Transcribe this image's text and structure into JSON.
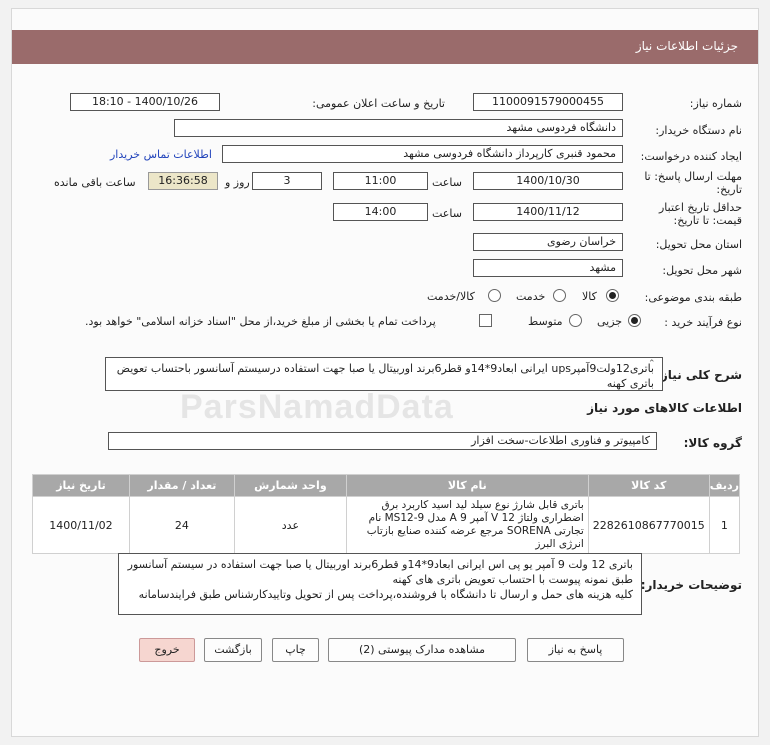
{
  "header": {
    "title": "جزئیات اطلاعات نیاز"
  },
  "need_number": {
    "label": "شماره نیاز:",
    "value": "1100091579000455"
  },
  "announce": {
    "label": "تاریخ و ساعت اعلان عمومی:",
    "value": "1400/10/26 - 18:10"
  },
  "buyer_org": {
    "label": "نام دستگاه خریدار:",
    "value": "دانشگاه فردوسی مشهد"
  },
  "requester": {
    "label": "ایجاد کننده درخواست:",
    "value": "محمود قنبری کارپرداز دانشگاه فردوسی مشهد",
    "contact_link": "اطلاعات تماس خریدار"
  },
  "deadline": {
    "label_line1": "مهلت ارسال پاسخ: تا",
    "label_line2": "تاریخ:",
    "date": "1400/10/30",
    "time_label": "ساعت",
    "time": "11:00",
    "days": "3",
    "days_label": "روز و",
    "remaining": "16:36:58",
    "remaining_label": "ساعت باقی مانده"
  },
  "validity": {
    "label_line1": "حداقل تاریخ اعتبار",
    "label_line2": "قیمت: تا تاریخ:",
    "date": "1400/11/12",
    "time_label": "ساعت",
    "time": "14:00"
  },
  "province": {
    "label": "استان محل تحویل:",
    "value": "خراسان رضوی"
  },
  "city": {
    "label": "شهر محل تحویل:",
    "value": "مشهد"
  },
  "category": {
    "label": "طبقه بندی موضوعی:",
    "options": [
      "کالا",
      "خدمت",
      "کالا/خدمت"
    ],
    "selected": "کالا"
  },
  "process": {
    "label": "نوع فرآیند خرید :",
    "options": [
      "جزیی",
      "متوسط"
    ],
    "selected": "جزیی",
    "payment_note": "پرداخت تمام یا بخشی از مبلغ خرید،از محل \"اسناد خزانه اسلامی\" خواهد بود."
  },
  "summary": {
    "label": "شرح کلی نیاز:",
    "value": "باتری12ولت9آمپرups ایرانی ابعاد9*14و قطر6برند اوربیتال یا صبا جهت استفاده درسیستم آسانسور باحتساب تعویض باتری کهنه"
  },
  "goods_info": {
    "title": "اطلاعات کالاهای مورد نیاز"
  },
  "goods_group": {
    "label": "گروه کالا:",
    "value": "کامپیوتر و فناوری اطلاعات-سخت افزار"
  },
  "table": {
    "headers": [
      "ردیف",
      "کد کالا",
      "نام کالا",
      "واحد شمارش",
      "تعداد / مقدار",
      "تاریخ نیاز"
    ],
    "rows": [
      {
        "row": "1",
        "code": "2282610867770015",
        "name": "باتری قابل شارژ نوع سیلد لید اسید کاربرد برق اضطراری ولتاژ 12 V آمپر 9 A مدل MS12-9 نام تجارتی SORENA مرجع عرضه کننده صنایع بازتاب انرژی البرز",
        "unit": "عدد",
        "qty": "24",
        "date": "1400/11/02"
      }
    ]
  },
  "buyer_notes": {
    "label": "توضیحات خریدار:",
    "value": "باتری 12 ولت 9 آمپر یو پی اس ایرانی ابعاد9*14و قطر6برند اوربیتال یا صبا جهت استفاده در سیستم آسانسور طبق نمونه پیوست با احتساب تعویض باتری های کهنه\nکلیه هزینه های حمل و ارسال تا دانشگاه با فروشنده،پرداخت پس از تحویل وتاییدکارشناس طبق فرایندسامانه"
  },
  "buttons": {
    "reply": "پاسخ به نیاز",
    "view_docs": "مشاهده مدارک پیوستی (2)",
    "print": "چاپ",
    "back": "بازگشت",
    "exit": "خروج"
  },
  "watermark": "ParsNamadData",
  "colors": {
    "header": "#9a6b6b",
    "table_header": "#a8a8a8",
    "link": "#2244bb",
    "exit_button": "#f6d6d0"
  }
}
